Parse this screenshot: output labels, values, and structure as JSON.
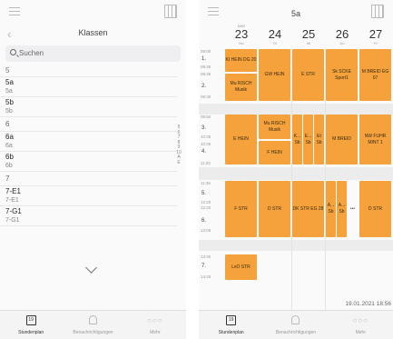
{
  "left": {
    "title": "Klassen",
    "search_placeholder": "Suchen",
    "top_partial": "5",
    "items": [
      {
        "name": "5a",
        "sub": "5a"
      },
      {
        "name": "5b",
        "sub": "5b"
      }
    ],
    "sec6": "6",
    "items6": [
      {
        "name": "6a",
        "sub": "6a"
      },
      {
        "name": "6b",
        "sub": "6b"
      }
    ],
    "sec7": "7",
    "items7": [
      {
        "name": "7-E1",
        "sub": "7-E1"
      },
      {
        "name": "7-G1",
        "sub": "7-G1"
      }
    ],
    "index": [
      "5",
      "6",
      "7",
      "8",
      "9",
      "10",
      "A",
      "E"
    ],
    "tabs": [
      "Stundenplan",
      "Benachrichtigungen",
      "Mehr"
    ],
    "cal_num": "19"
  },
  "right": {
    "title": "5a",
    "days": [
      {
        "mon": "MäR",
        "num": "23",
        "dn": "Mo"
      },
      {
        "mon": "",
        "num": "24",
        "dn": "Di"
      },
      {
        "mon": "",
        "num": "25",
        "dn": "Mi"
      },
      {
        "mon": "",
        "num": "26",
        "dn": "Do"
      },
      {
        "mon": "",
        "num": "27",
        "dn": "Fr"
      }
    ],
    "periods": [
      {
        "n": "1.",
        "from": "08:00",
        "to": "08:45"
      },
      {
        "n": "2.",
        "from": "08:45",
        "to": "09:30"
      },
      {
        "n": "3.",
        "from": "09:50",
        "to": "10:35"
      },
      {
        "n": "4.",
        "from": "10:35",
        "to": "11:20"
      },
      {
        "n": "5.",
        "from": "11:35",
        "to": "12:20"
      },
      {
        "n": "6.",
        "from": "12:20",
        "to": "13:05"
      },
      {
        "n": "7.",
        "from": "13:40",
        "to": "14:25"
      }
    ],
    "events": {
      "mo_1": "KI HEIN DG 20",
      "mo_2": "Mu RISCH Musik",
      "di_12": "GW HEIN",
      "mi_12": "E STR",
      "do_12": "Sk SCKE Sport1",
      "fr_12": "M BREID EG 07",
      "mo_34": "E HEIN",
      "di_3": "Mu RISCH Musik",
      "di_4": "F HEIN",
      "mi_a": "K... Sb",
      "mi_b": "E... Sb",
      "mi_c": "Et Sb",
      "do_34": "M BREID",
      "fr_34": "NW FUHR MINT 1",
      "mo_56": "F STR",
      "di_56": "D STR",
      "mi_56": "DK STR EG 28",
      "do_a": "A... Sb",
      "do_b": "A... Sb",
      "do_more": "•••",
      "fr_56": "D STR",
      "mo_7": "LsO STR"
    },
    "timestamp": "19.01.2021 18:56",
    "tabs": [
      "Stundenplan",
      "Benachrichtigungen",
      "Mehr"
    ],
    "cal_num": "19"
  },
  "colors": {
    "event": "#f5a23c",
    "break_band": "#ececec"
  }
}
